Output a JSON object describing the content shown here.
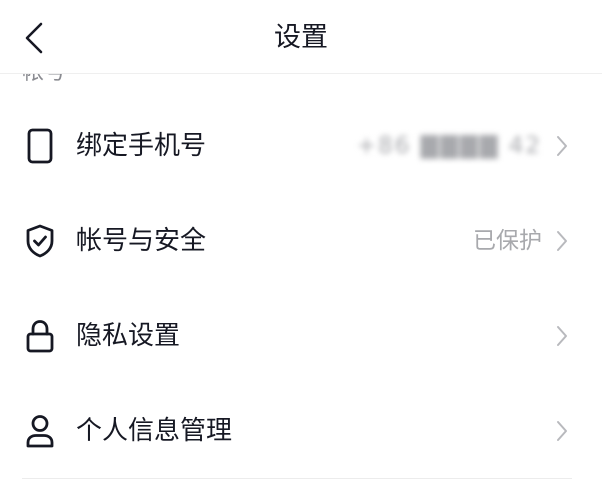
{
  "header": {
    "title": "设置"
  },
  "section": {
    "label": "帐号"
  },
  "rows": [
    {
      "icon": "phone-icon",
      "label": "绑定手机号",
      "value": "+86 ▇▇▇▇ 42"
    },
    {
      "icon": "shield-check-icon",
      "label": "帐号与安全",
      "value": "已保护"
    },
    {
      "icon": "lock-icon",
      "label": "隐私设置",
      "value": ""
    },
    {
      "icon": "person-icon",
      "label": "个人信息管理",
      "value": ""
    }
  ],
  "colors": {
    "text": "#161823",
    "secondary": "#a8a9ad",
    "divider": "#ececec"
  }
}
